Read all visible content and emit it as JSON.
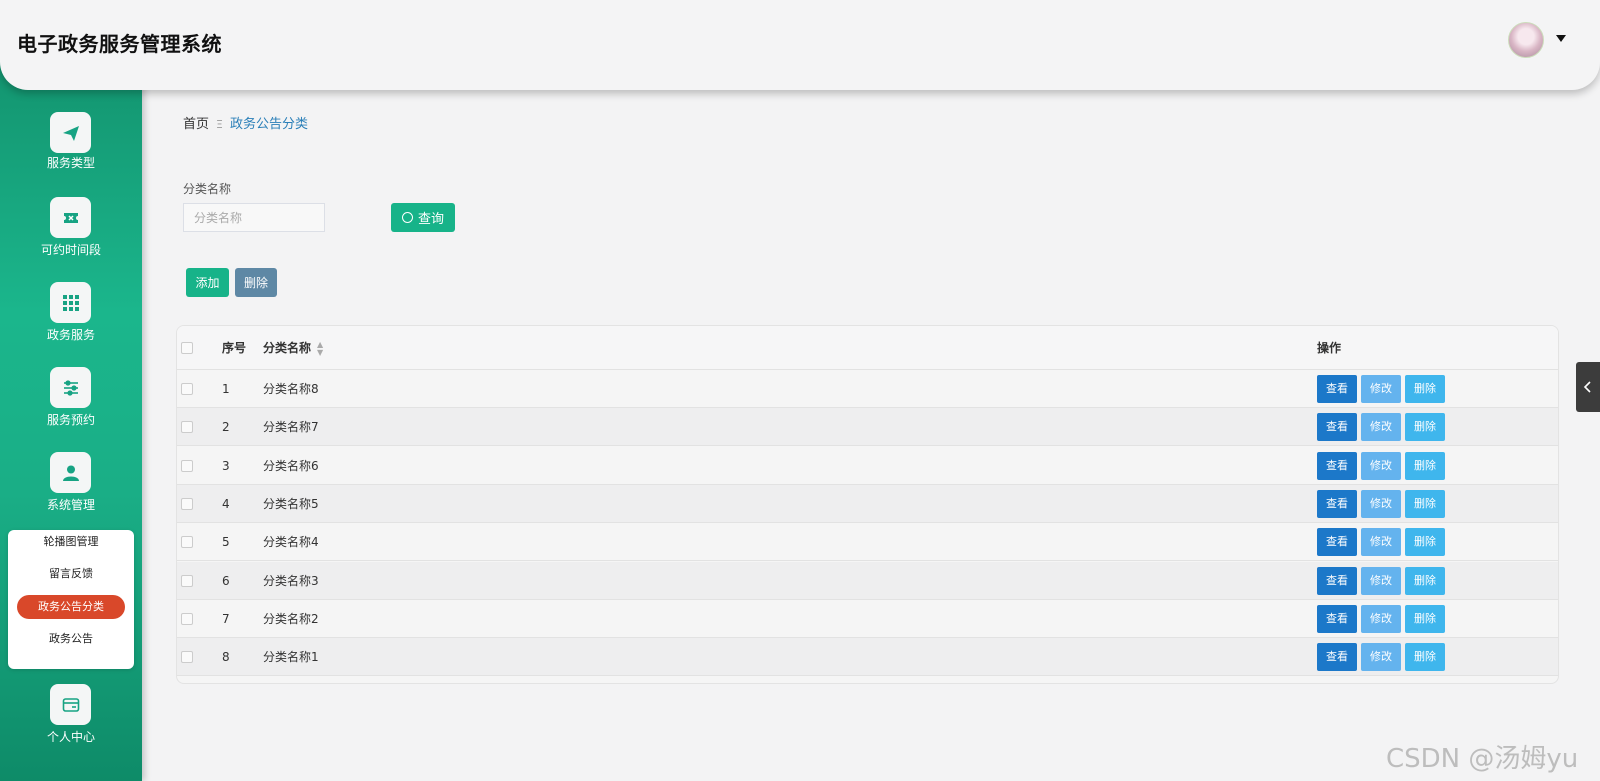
{
  "header": {
    "title": "电子政务服务管理系统"
  },
  "sidebar": {
    "items": [
      {
        "label": "服务类型",
        "icon": "send-icon"
      },
      {
        "label": "可约时间段",
        "icon": "ticket-icon"
      },
      {
        "label": "政务服务",
        "icon": "grid-icon"
      },
      {
        "label": "服务预约",
        "icon": "sliders-icon"
      },
      {
        "label": "系统管理",
        "icon": "user-icon"
      },
      {
        "label": "个人中心",
        "icon": "card-icon"
      }
    ],
    "submenu": [
      "轮播图管理",
      "留言反馈",
      "政务公告分类",
      "政务公告"
    ]
  },
  "breadcrumb": {
    "home": "首页",
    "separator": "Ξ",
    "current": "政务公告分类"
  },
  "filter": {
    "label": "分类名称",
    "placeholder": "分类名称",
    "query_label": "查询"
  },
  "actions": {
    "add_label": "添加",
    "delete_label": "删除"
  },
  "table": {
    "headers": [
      "序号",
      "分类名称",
      "操作"
    ],
    "rows": [
      {
        "index": "1",
        "name": "分类名称8"
      },
      {
        "index": "2",
        "name": "分类名称7"
      },
      {
        "index": "3",
        "name": "分类名称6"
      },
      {
        "index": "4",
        "name": "分类名称5"
      },
      {
        "index": "5",
        "name": "分类名称4"
      },
      {
        "index": "6",
        "name": "分类名称3"
      },
      {
        "index": "7",
        "name": "分类名称2"
      },
      {
        "index": "8",
        "name": "分类名称1"
      }
    ],
    "row_actions": {
      "view": "查看",
      "edit": "修改",
      "delete": "删除"
    }
  },
  "watermark": "CSDN @汤姆yu",
  "colors": {
    "primary": "#17b389",
    "active_menu": "#d9482a",
    "view_button": "#1c78c9",
    "edit_button": "#64b3ee",
    "delete_button": "#3fb6ed"
  }
}
